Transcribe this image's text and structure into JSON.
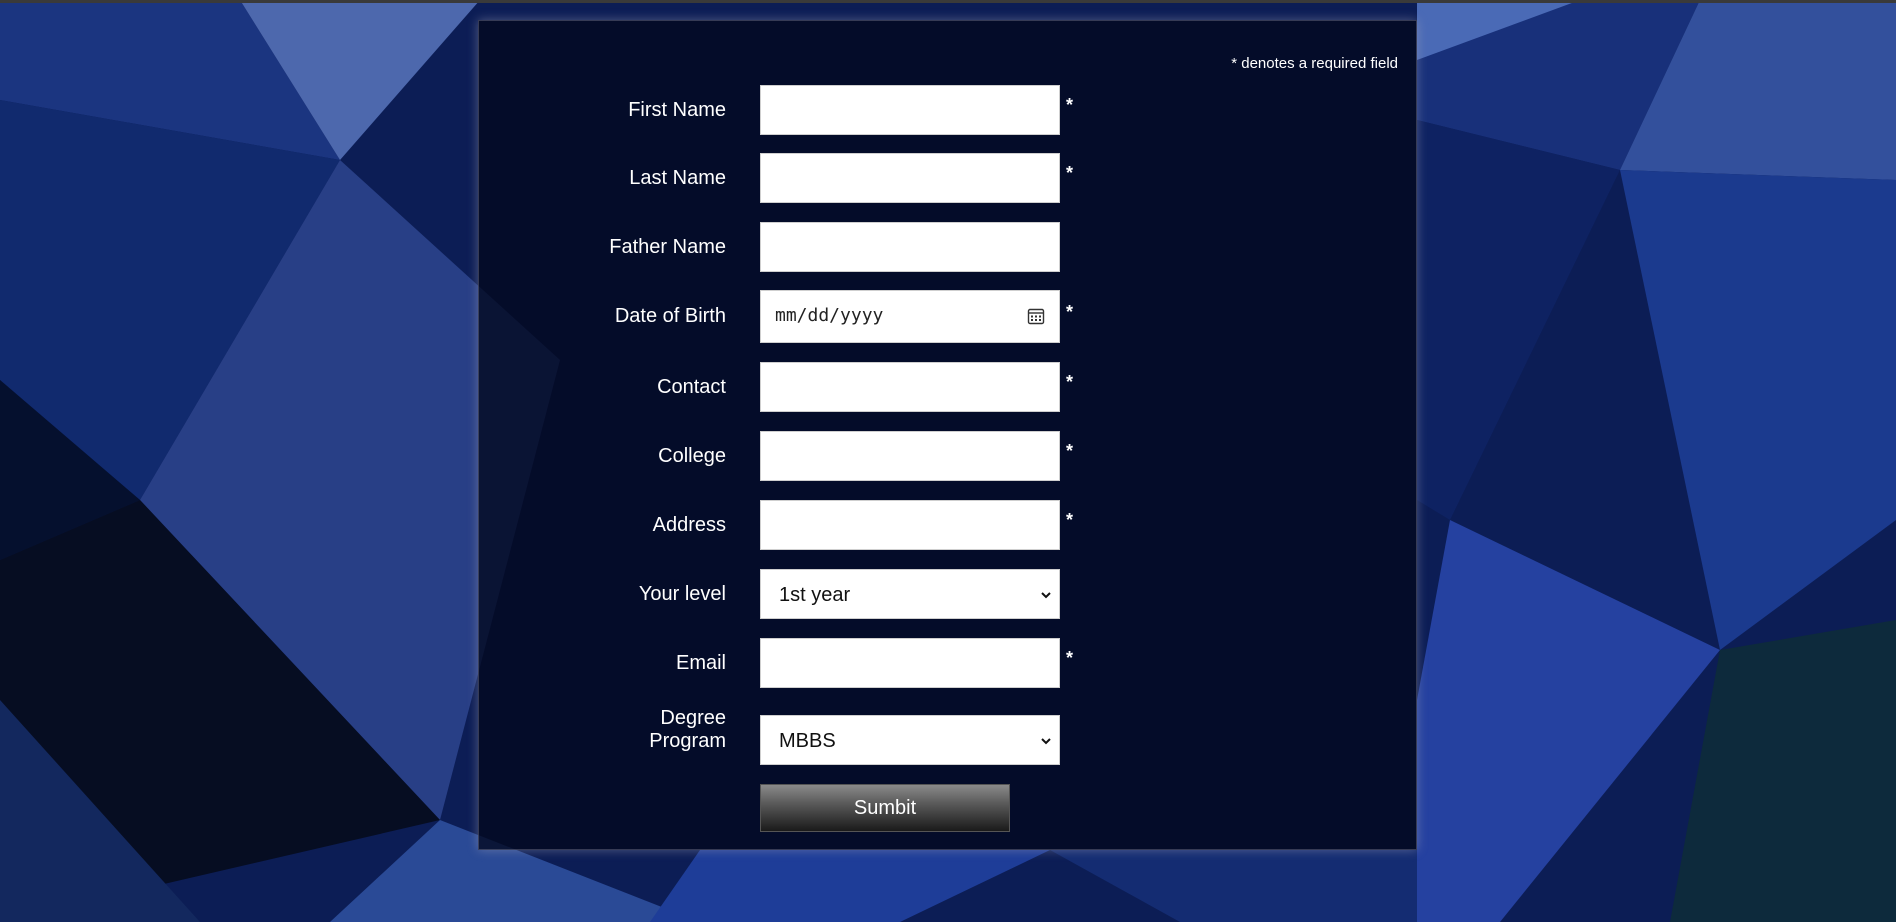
{
  "form": {
    "required_note": "* denotes a required field",
    "required_marker": "*",
    "fields": {
      "first_name": {
        "label": "First Name",
        "value": "",
        "required": true
      },
      "last_name": {
        "label": "Last Name",
        "value": "",
        "required": true
      },
      "father_name": {
        "label": "Father Name",
        "value": "",
        "required": false
      },
      "date_of_birth": {
        "label": "Date of Birth",
        "placeholder": "mm/dd/yyyy",
        "required": true
      },
      "contact": {
        "label": "Contact",
        "value": "",
        "required": true
      },
      "college": {
        "label": "College",
        "value": "",
        "required": true
      },
      "address": {
        "label": "Address",
        "value": "",
        "required": true
      },
      "level": {
        "label": "Your level",
        "selected": "1st year",
        "required": false
      },
      "email": {
        "label": "Email",
        "value": "",
        "required": true
      },
      "degree_program": {
        "label_line1": "Degree",
        "label_line2": "Program",
        "selected": "MBBS",
        "required": false
      }
    },
    "submit_label": "Sumbit"
  },
  "icons": {
    "calendar": "calendar-icon",
    "dropdown": "chevron-down-icon"
  },
  "colors": {
    "background": "#0b1a4a",
    "panel": "#02081e",
    "text": "#ffffff"
  }
}
